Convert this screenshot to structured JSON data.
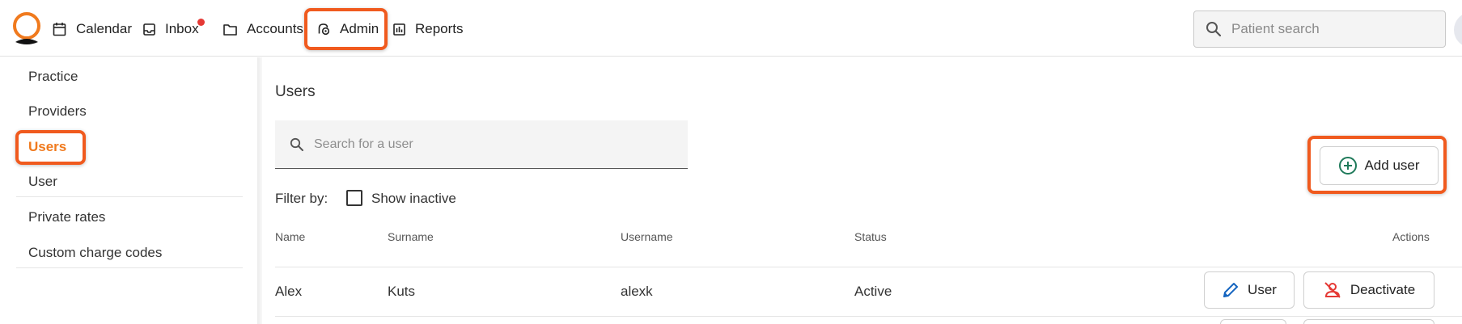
{
  "nav": {
    "items": [
      {
        "label": "Calendar",
        "icon": "calendar-icon"
      },
      {
        "label": "Inbox",
        "icon": "inbox-icon",
        "badge": true
      },
      {
        "label": "Accounts",
        "icon": "folder-icon"
      },
      {
        "label": "Admin",
        "icon": "admin-cog-icon"
      },
      {
        "label": "Reports",
        "icon": "bar-chart-icon"
      }
    ],
    "patient_search_placeholder": "Patient search"
  },
  "sidebar": {
    "items": [
      {
        "label": "Practice"
      },
      {
        "label": "Providers"
      },
      {
        "label": "Users",
        "active": true
      },
      {
        "label": "User"
      },
      {
        "label": "Private rates"
      },
      {
        "label": "Custom charge codes"
      }
    ]
  },
  "main": {
    "title": "Users",
    "search_placeholder": "Search for a user",
    "filter_label": "Filter by:",
    "show_inactive_label": "Show inactive",
    "show_inactive_checked": false,
    "add_user_label": "Add user"
  },
  "table": {
    "columns": [
      "Name",
      "Surname",
      "Username",
      "Status",
      "Actions"
    ],
    "rows": [
      {
        "name": "Alex",
        "surname": "Kuts",
        "username": "alexk",
        "status": "Active",
        "edit_label": "User",
        "deactivate_label": "Deactivate"
      }
    ]
  },
  "colors": {
    "accent": "#f07a1e",
    "highlight": "#f05a1e",
    "badge": "#e53935",
    "add_icon": "#1f7a5a",
    "edit_icon": "#1565c0",
    "deactivate_icon": "#e53935"
  }
}
